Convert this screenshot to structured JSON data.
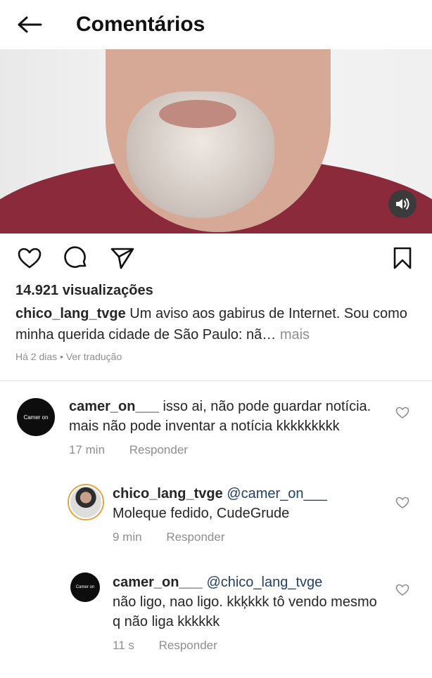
{
  "header": {
    "title": "Comentários"
  },
  "post": {
    "views": "14.921 visualizações",
    "author": "chico_lang_tvge",
    "caption": "Um aviso aos gabirus de Internet. Sou como minha querida cidade de São Paulo: nã…",
    "more": "mais",
    "time": "Há 2 dias",
    "separator": "•",
    "translate": "Ver tradução"
  },
  "comments": [
    {
      "user": "camer_on___",
      "mention": "",
      "text": "isso ai, não pode guardar notícia. mais não pode inventar a notícia kkkkkkkkk",
      "time": "17 min",
      "reply": "Responder",
      "avatar_text": "Camer on"
    },
    {
      "user": "chico_lang_tvge",
      "mention": "@camer_on___",
      "text": "Moleque fedido, CudeGrude",
      "time": "9 min",
      "reply": "Responder"
    },
    {
      "user": "camer_on___",
      "mention": "@chico_lang_tvge",
      "text": "não ligo, nao ligo. kkķkkk tô vendo mesmo q não liga kkkkkk",
      "time": "11 s",
      "reply": "Responder",
      "avatar_text": "Camer on"
    }
  ],
  "colors": {
    "text": "#262626",
    "muted": "#8e8e8e",
    "mention": "#22406b",
    "divider": "#dbdbdb"
  },
  "icons": {
    "back": "arrow-left-icon",
    "like": "heart-icon",
    "comment": "speech-bubble-icon",
    "share": "paper-plane-icon",
    "save": "bookmark-icon",
    "sound": "speaker-icon"
  }
}
